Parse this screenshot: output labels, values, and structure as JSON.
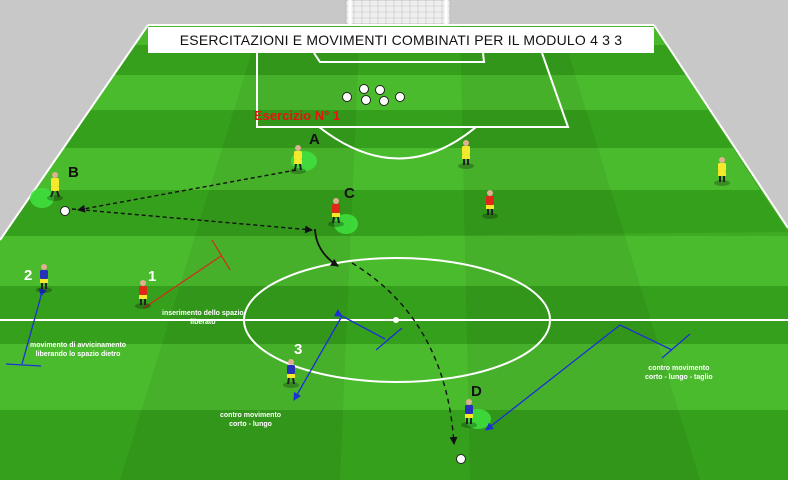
{
  "title": "ESERCITAZIONI E MOVIMENTI COMBINATI PER IL MODULO 4 3 3",
  "exercise_label": "Esercizio N° 1",
  "colors": {
    "field_light": "#4cb82c",
    "field_dark": "#2d9419",
    "lines": "#ffffff",
    "team_yellow": "#f4e92a",
    "team_red": "#e22718",
    "team_blue": "#2630b8",
    "marker_green": "#3fe23f",
    "arrow_blue": "#1d2fd8",
    "arrow_red": "#d52a1a",
    "label_red": "#e8140c"
  },
  "player_labels": {
    "A": "A",
    "B": "B",
    "C": "C",
    "D": "D",
    "n1": "1",
    "n2": "2",
    "n3": "3"
  },
  "notes": {
    "inserimento_1": "inserimento dello spazio",
    "inserimento_2": "liberato",
    "avvicinamento_1": "movimento di avvicinamento",
    "avvicinamento_2": "liberando lo spazio dietro",
    "contro_lungo_1": "contro movimento",
    "contro_lungo_2": "corto - lungo",
    "contro_taglio_1": "contro movimento",
    "contro_taglio_2": "corto - lungo - taglio"
  },
  "icons": [
    "goal-net",
    "soccer-ball",
    "arrow-dashed",
    "arrow-solid",
    "player-figure",
    "highlight-disc"
  ]
}
